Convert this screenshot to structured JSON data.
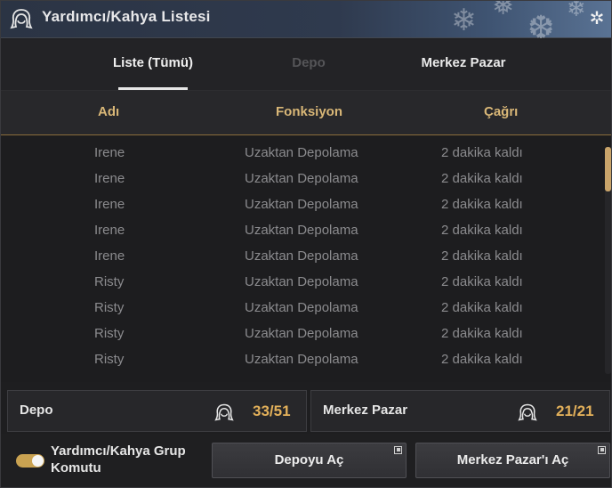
{
  "window": {
    "title": "Yardımcı/Kahya Listesi",
    "title_icon": "maid-icon",
    "close_icon": "close-snowflake-icon",
    "accent_color": "#e2b05a"
  },
  "tabs": [
    {
      "label": "Liste (Tümü)",
      "state": "active"
    },
    {
      "label": "Depo",
      "state": "disabled"
    },
    {
      "label": "Merkez Pazar",
      "state": "normal"
    }
  ],
  "table": {
    "headers": [
      "Adı",
      "Fonksiyon",
      "Çağrı"
    ],
    "rows": [
      {
        "name": "Irene",
        "function": "Uzaktan Depolama",
        "call": "2 dakika kaldı"
      },
      {
        "name": "Irene",
        "function": "Uzaktan Depolama",
        "call": "2 dakika kaldı"
      },
      {
        "name": "Irene",
        "function": "Uzaktan Depolama",
        "call": "2 dakika kaldı"
      },
      {
        "name": "Irene",
        "function": "Uzaktan Depolama",
        "call": "2 dakika kaldı"
      },
      {
        "name": "Irene",
        "function": "Uzaktan Depolama",
        "call": "2 dakika kaldı"
      },
      {
        "name": "Risty",
        "function": "Uzaktan Depolama",
        "call": "2 dakika kaldı"
      },
      {
        "name": "Risty",
        "function": "Uzaktan Depolama",
        "call": "2 dakika kaldı"
      },
      {
        "name": "Risty",
        "function": "Uzaktan Depolama",
        "call": "2 dakika kaldı"
      },
      {
        "name": "Risty",
        "function": "Uzaktan Depolama",
        "call": "2 dakika kaldı"
      }
    ]
  },
  "panels": {
    "storage": {
      "label": "Depo",
      "count": "33/51",
      "icon": "maid-icon"
    },
    "market": {
      "label": "Merkez Pazar",
      "count": "21/21",
      "icon": "maid-icon"
    }
  },
  "footer": {
    "toggle_label": "Yardımcı/Kahya Grup Komutu",
    "toggle_on": true,
    "open_storage_label": "Depoyu Aç",
    "open_market_label": "Merkez Pazar'ı Aç"
  }
}
